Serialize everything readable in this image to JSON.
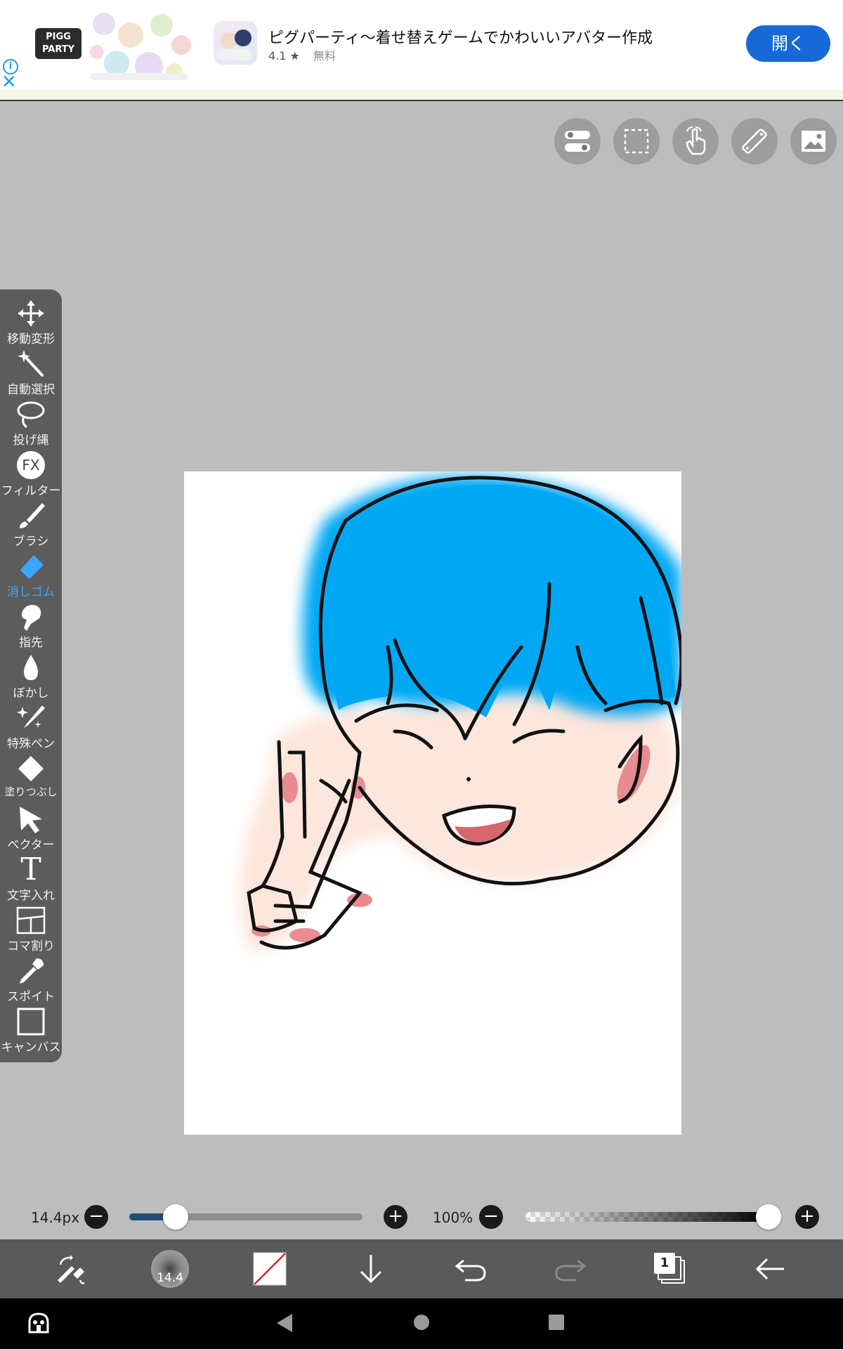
{
  "ad": {
    "logo_line1": "PIGG",
    "logo_line2": "PARTY",
    "title": "ピグパーティ〜着せ替えゲームでかわいいアバター作成",
    "rating": "4.1",
    "rating_star": "★",
    "price": "無料",
    "open_label": "開く",
    "info_glyph": "i",
    "close_glyph": "✕"
  },
  "top_toolbar": [
    {
      "name": "toggle-icon"
    },
    {
      "name": "selection-icon"
    },
    {
      "name": "hand-icon"
    },
    {
      "name": "ruler-icon"
    },
    {
      "name": "image-icon"
    }
  ],
  "tools": [
    {
      "label": "移動変形",
      "icon": "move-icon"
    },
    {
      "label": "自動選択",
      "icon": "magic-wand-icon"
    },
    {
      "label": "投げ縄",
      "icon": "lasso-icon"
    },
    {
      "label": "フィルター",
      "icon": "fx-icon"
    },
    {
      "label": "ブラシ",
      "icon": "brush-icon"
    },
    {
      "label": "消しゴム",
      "icon": "eraser-icon",
      "active": true
    },
    {
      "label": "指先",
      "icon": "finger-icon"
    },
    {
      "label": "ぼかし",
      "icon": "blur-icon"
    },
    {
      "label": "特殊ペン",
      "icon": "special-pen-icon"
    },
    {
      "label": "塗りつぶし",
      "icon": "fill-icon"
    },
    {
      "label": "ベクター",
      "icon": "vector-icon"
    },
    {
      "label": "文字入れ",
      "icon": "text-icon"
    },
    {
      "label": "コマ割り",
      "icon": "panel-icon"
    },
    {
      "label": "スポイト",
      "icon": "eyedropper-icon"
    },
    {
      "label": "キャンバス",
      "icon": "canvas-icon"
    }
  ],
  "fx_glyph": "FX",
  "text_glyph": "T",
  "brush_size": {
    "label": "14.4px",
    "value_fraction": 0.2
  },
  "opacity": {
    "label": "100%",
    "value_fraction": 1.0
  },
  "minus_glyph": "−",
  "plus_glyph": "+",
  "bottom_toolbar": {
    "brush_size_badge": "14.4",
    "layer_count": "1"
  },
  "colors": {
    "accent_blue": "#3aa6ff",
    "hair_blue": "#00a8f4",
    "skin": "#fde6dc",
    "blush": "#e98c92",
    "open_button": "#1769d8"
  }
}
